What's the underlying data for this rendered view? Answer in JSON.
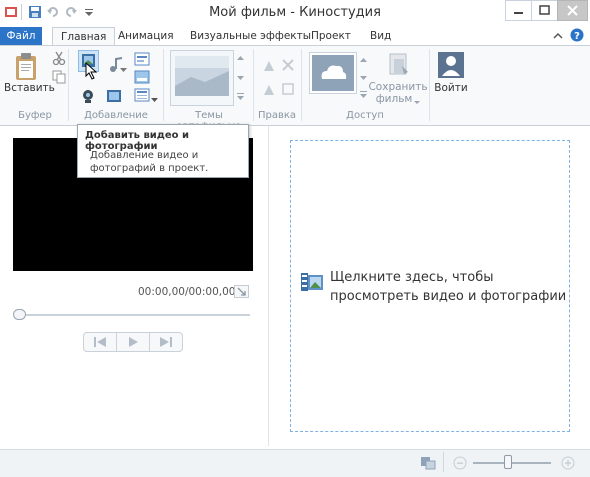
{
  "window": {
    "title": "Мой фильм - Киностудия"
  },
  "tabs": {
    "file": "Файл",
    "home": "Главная",
    "animation": "Анимация",
    "visual_effects": "Визуальные эффекты",
    "project": "Проект",
    "view": "Вид"
  },
  "ribbon": {
    "paste_label": "Вставить",
    "groups": {
      "clipboard": "Буфер",
      "add": "Добавление",
      "themes": "Темы автофильма",
      "edit": "Правка",
      "share": "Доступ"
    },
    "save_movie_line1": "Сохранить",
    "save_movie_line2": "фильм",
    "signin_label": "Войти"
  },
  "tooltip": {
    "title": "Добавить видео и фотографии",
    "description": "Добавление видео и фотографий в проект."
  },
  "preview": {
    "timecode": "00:00,00/00:00,00",
    "seek_fraction": 0
  },
  "storyboard": {
    "hint": "Щелкните здесь, чтобы просмотреть видео и фотографии"
  },
  "colors": {
    "file_tab": "#2b74c7",
    "storyboard_border": "#7fb2e5"
  }
}
